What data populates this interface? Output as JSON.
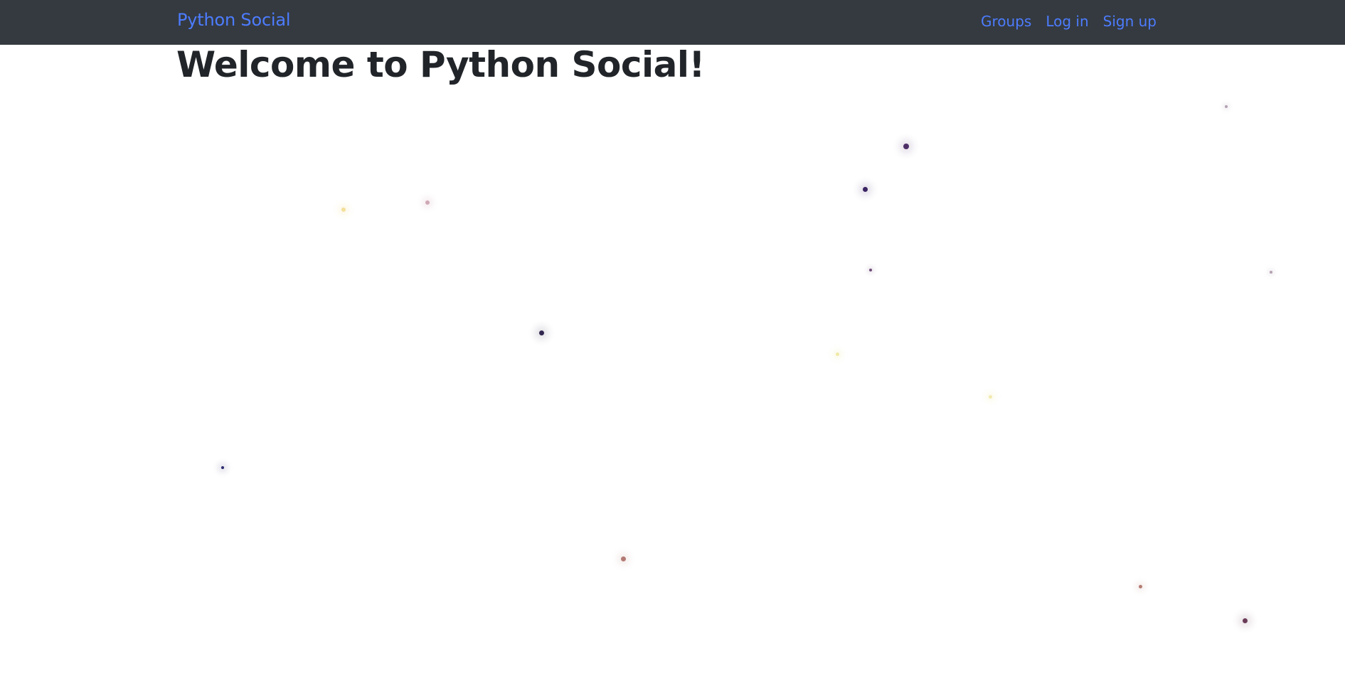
{
  "navbar": {
    "brand": "Python Social",
    "links": [
      {
        "label": "Groups"
      },
      {
        "label": "Log in"
      },
      {
        "label": "Sign up"
      }
    ]
  },
  "main": {
    "title": "Welcome to Python Social!"
  },
  "colors": {
    "navbar_bg": "#343a40",
    "link": "#4d7cff",
    "title": "#212529"
  }
}
